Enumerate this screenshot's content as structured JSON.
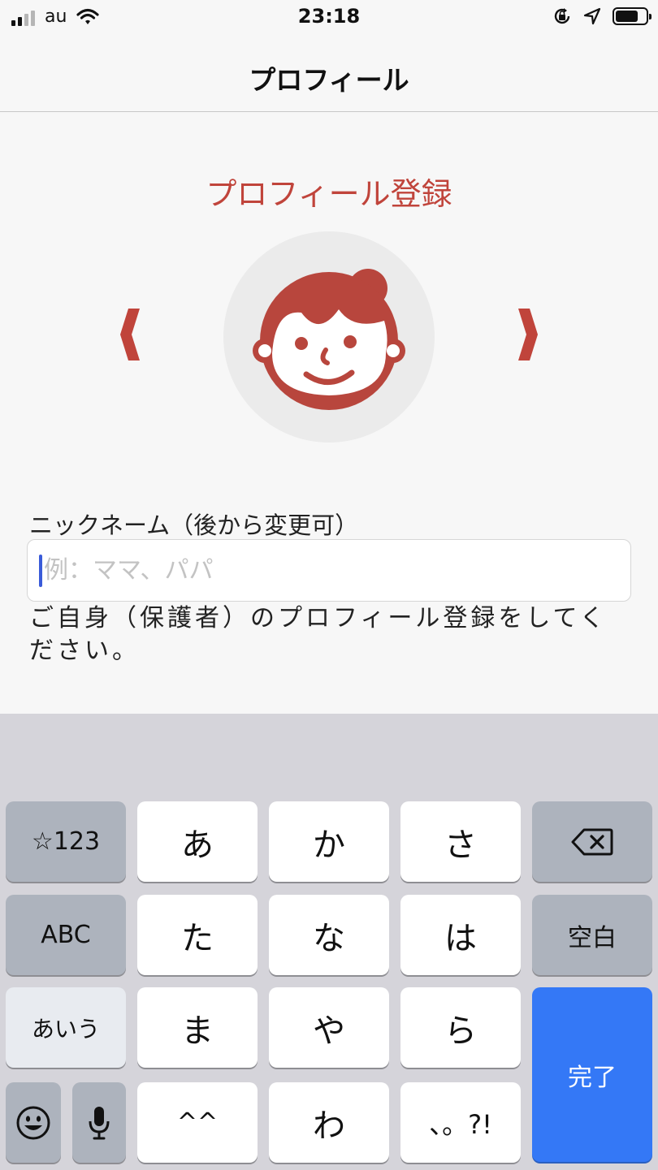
{
  "status_bar": {
    "carrier": "au",
    "time": "23:18",
    "battery_level": 0.75,
    "icons": [
      "signal-icon",
      "wifi-icon",
      "orientation-lock-icon",
      "location-icon",
      "battery-icon"
    ]
  },
  "nav": {
    "title": "プロフィール"
  },
  "profile": {
    "title": "プロフィール登録",
    "avatar_icon": "woman-face-icon",
    "prev_icon": "chevron-left-icon",
    "next_icon": "chevron-right-icon"
  },
  "nickname": {
    "label": "ニックネーム（後から変更可）",
    "placeholder": "例：ママ、パパ",
    "value": ""
  },
  "hint": "ご自身（保護者）のプロフィール登録をしてください。",
  "keyboard": {
    "row1": [
      "☆123",
      "あ",
      "か",
      "さ"
    ],
    "row2": [
      "ABC",
      "た",
      "な",
      "は",
      "空白"
    ],
    "row3": [
      "あいう",
      "ま",
      "や",
      "ら"
    ],
    "row4": [
      "^^",
      "わ",
      "、。?!"
    ],
    "done": "完了",
    "icons": [
      "backspace-icon",
      "emoji-icon",
      "microphone-icon"
    ]
  },
  "colors": {
    "accent": "#c0443b",
    "done_key": "#3478f6"
  }
}
